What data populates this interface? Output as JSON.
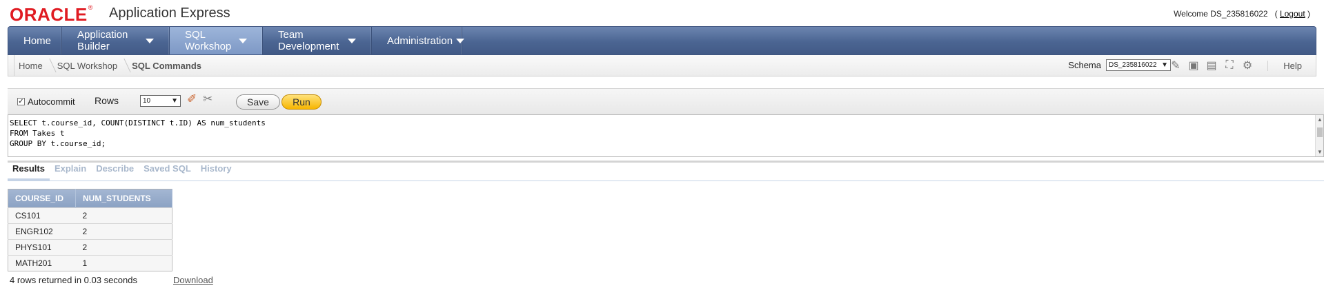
{
  "header": {
    "brand": "ORACLE",
    "app_name": "Application Express",
    "welcome_text": "Welcome DS_235816022",
    "logout_label": "Logout"
  },
  "nav": {
    "items": [
      {
        "label": "Home",
        "has_menu": false
      },
      {
        "label": "Application Builder",
        "has_menu": true
      },
      {
        "label": "SQL Workshop",
        "has_menu": true,
        "active": true
      },
      {
        "label": "Team Development",
        "has_menu": true
      },
      {
        "label": "Administration",
        "has_menu": true
      }
    ]
  },
  "breadcrumb": [
    "Home",
    "SQL Workshop",
    "SQL Commands"
  ],
  "schema": {
    "label": "Schema",
    "value": "DS_235816022"
  },
  "toolbar_icons": [
    "find-icon",
    "sql-scripts-icon",
    "object-browser-icon",
    "query-builder-icon",
    "settings-icon"
  ],
  "help_label": "Help",
  "commands": {
    "autocommit_label": "Autocommit",
    "autocommit_checked": true,
    "rows_label": "Rows",
    "rows_value": "10",
    "save_label": "Save",
    "run_label": "Run"
  },
  "editor": {
    "sql": "SELECT t.course_id, COUNT(DISTINCT t.ID) AS num_students\nFROM Takes t\nGROUP BY t.course_id;"
  },
  "tabs": [
    "Results",
    "Explain",
    "Describe",
    "Saved SQL",
    "History"
  ],
  "results": {
    "columns": [
      "COURSE_ID",
      "NUM_STUDENTS"
    ],
    "rows": [
      [
        "CS101",
        "2"
      ],
      [
        "ENGR102",
        "2"
      ],
      [
        "PHYS101",
        "2"
      ],
      [
        "MATH201",
        "1"
      ]
    ],
    "status": "4 rows returned in 0.03 seconds",
    "download_label": "Download"
  },
  "colors": {
    "brand_red": "#e01b22",
    "nav_blue": "#4b6592",
    "run_yellow": "#f7b500",
    "header_blue": "#8aa1c3"
  }
}
